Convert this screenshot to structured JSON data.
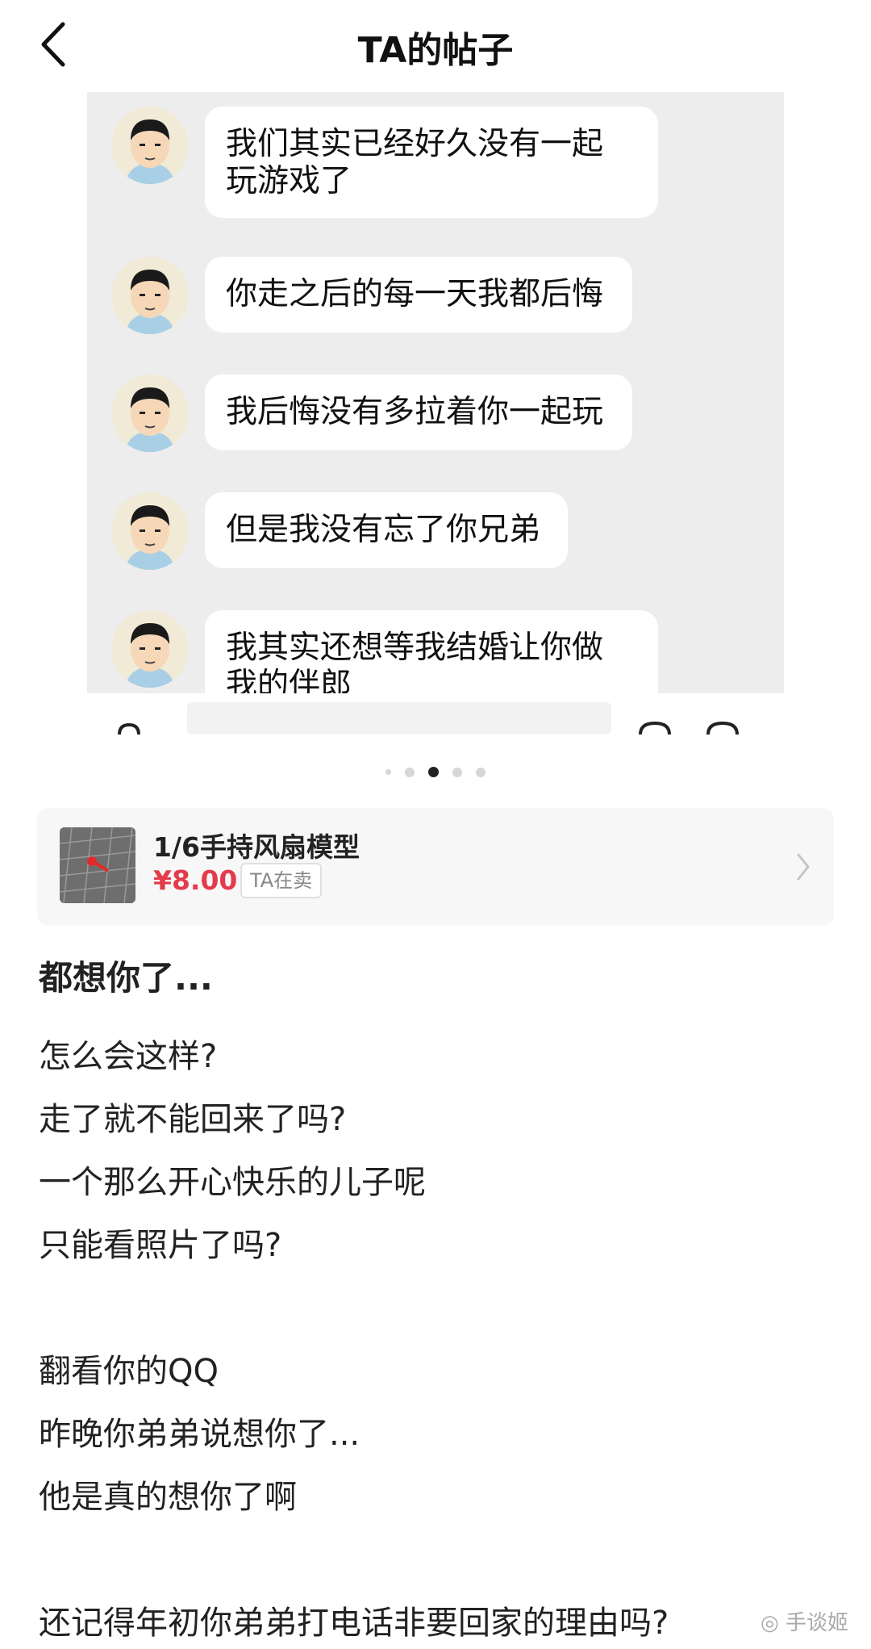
{
  "header": {
    "title": "TA的帖子"
  },
  "chat": {
    "messages": [
      {
        "line1": "我们其实已经好久没有一起",
        "line2": "玩游戏了"
      },
      {
        "line1": "你走之后的每一天我都后悔"
      },
      {
        "line1": "我后悔没有多拉着你一起玩"
      },
      {
        "line1": "但是我没有忘了你兄弟"
      },
      {
        "line1": "我其实还想等我结婚让你做",
        "line2": "我的伴郎"
      }
    ]
  },
  "carousel": {
    "pages": 5,
    "current_page": 3
  },
  "product": {
    "name": "1/6手持风扇模型",
    "price": "¥8.00",
    "badge": "TA在卖"
  },
  "post": {
    "title": "都想你了...",
    "lines": [
      "怎么会这样?",
      "走了就不能回来了吗?",
      "一个那么开心快乐的儿子呢",
      "只能看照片了吗?",
      "翻看你的QQ",
      "昨晚你弟弟说想你了...",
      "他是真的想你了啊",
      "还记得年初你弟弟打电话非要回家的理由吗?"
    ]
  },
  "watermark": {
    "text": "手谈姬"
  },
  "colors": {
    "price": "#e43b4b",
    "chat_bg": "#ededed",
    "bubble": "#ffffff"
  }
}
